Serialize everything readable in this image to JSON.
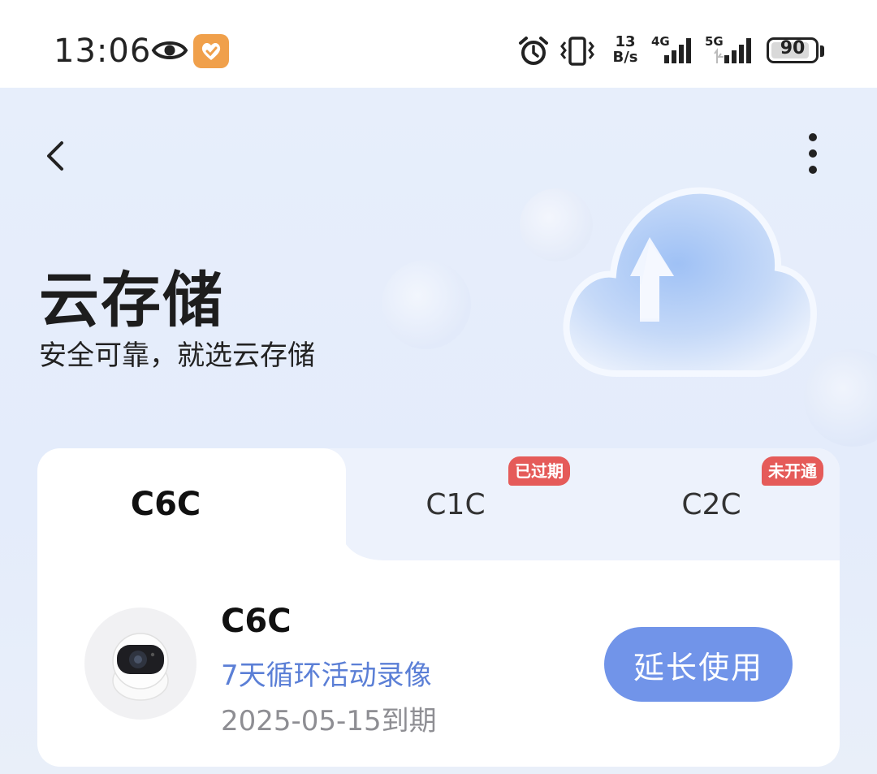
{
  "status_bar": {
    "time": "13:06",
    "speed_value": "13",
    "speed_unit": "B/s",
    "net1": "4G",
    "net2": "5G",
    "battery": "90",
    "battery_level": 0.9,
    "icons": [
      "eye-icon",
      "app-notification-icon",
      "alarm-icon",
      "vibrate-icon",
      "signal-icon",
      "battery-icon"
    ]
  },
  "header": {
    "title": "云存储",
    "subtitle": "安全可靠，就选云存储"
  },
  "tabs": [
    {
      "label": "C6C",
      "active": true,
      "badge": ""
    },
    {
      "label": "C1C",
      "active": false,
      "badge": "已过期"
    },
    {
      "label": "C2C",
      "active": false,
      "badge": "未开通"
    }
  ],
  "device": {
    "name": "C6C",
    "plan": "7天循环活动录像",
    "expiry": "2025-05-15到期",
    "action_label": "延长使用"
  },
  "colors": {
    "accent": "#7194e9",
    "plan_text": "#5b7fd6",
    "badge_red": "#e55b59",
    "background": "#e7eefb"
  }
}
